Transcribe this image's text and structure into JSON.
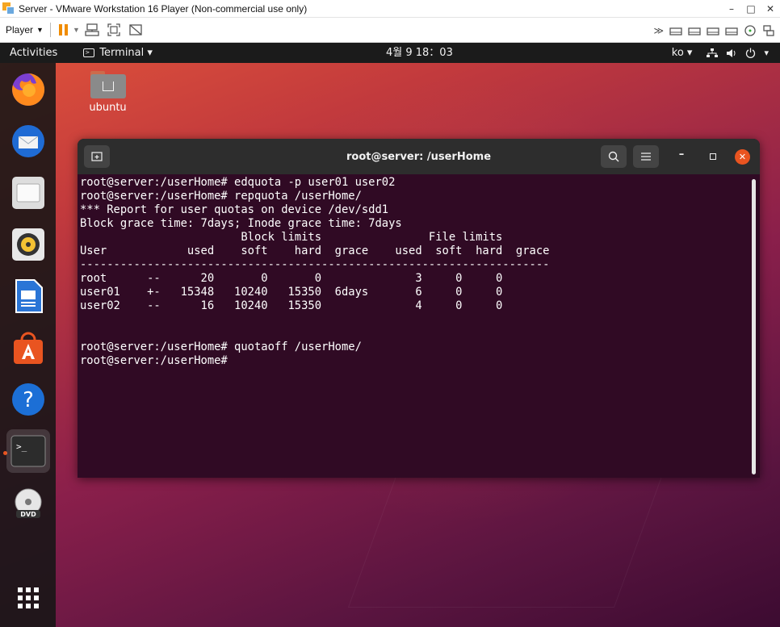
{
  "vmware": {
    "title": "Server - VMware Workstation 16 Player (Non-commercial use only)",
    "player_menu": "Player",
    "window_controls": [
      "–",
      "□",
      "✕"
    ]
  },
  "topbar": {
    "activities": "Activities",
    "app_menu": "Terminal ▾",
    "clock": "4월 9  18：03",
    "input_method": "ko ▾",
    "system_menu": "▾"
  },
  "desktop": {
    "home_label": "ubuntu"
  },
  "dock": {
    "items": [
      "firefox-icon",
      "thunderbird-icon",
      "files-icon",
      "rhythmbox-icon",
      "libreoffice-writer-icon",
      "software-icon",
      "help-icon",
      "terminal-icon",
      "dvd-icon",
      "show-apps-icon"
    ],
    "active": "terminal-icon",
    "accent": "#e95420"
  },
  "terminal": {
    "title": "root@server: /userHome",
    "lines": [
      "root@server:/userHome# edquota -p user01 user02",
      "root@server:/userHome# repquota /userHome/",
      "*** Report for user quotas on device /dev/sdd1",
      "Block grace time: 7days; Inode grace time: 7days",
      "                        Block limits                File limits",
      "User            used    soft    hard  grace    used  soft  hard  grace",
      "----------------------------------------------------------------------",
      "root      --      20       0       0              3     0     0",
      "user01    +-   15348   10240   15350  6days       6     0     0",
      "user02    --      16   10240   15350              4     0     0",
      "",
      "",
      "root@server:/userHome# quotaoff /userHome/",
      "root@server:/userHome# "
    ],
    "background": "#300a24"
  }
}
